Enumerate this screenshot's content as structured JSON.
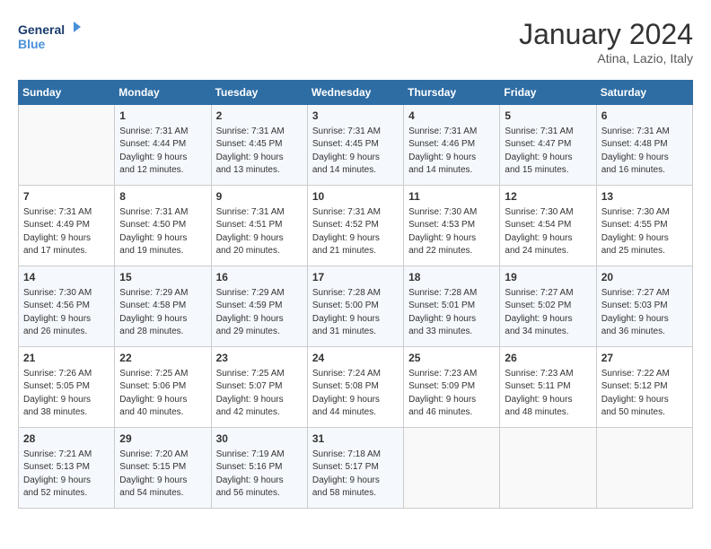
{
  "header": {
    "logo_line1": "General",
    "logo_line2": "Blue",
    "month": "January 2024",
    "location": "Atina, Lazio, Italy"
  },
  "weekdays": [
    "Sunday",
    "Monday",
    "Tuesday",
    "Wednesday",
    "Thursday",
    "Friday",
    "Saturday"
  ],
  "weeks": [
    [
      {
        "day": "",
        "info": ""
      },
      {
        "day": "1",
        "info": "Sunrise: 7:31 AM\nSunset: 4:44 PM\nDaylight: 9 hours\nand 12 minutes."
      },
      {
        "day": "2",
        "info": "Sunrise: 7:31 AM\nSunset: 4:45 PM\nDaylight: 9 hours\nand 13 minutes."
      },
      {
        "day": "3",
        "info": "Sunrise: 7:31 AM\nSunset: 4:45 PM\nDaylight: 9 hours\nand 14 minutes."
      },
      {
        "day": "4",
        "info": "Sunrise: 7:31 AM\nSunset: 4:46 PM\nDaylight: 9 hours\nand 14 minutes."
      },
      {
        "day": "5",
        "info": "Sunrise: 7:31 AM\nSunset: 4:47 PM\nDaylight: 9 hours\nand 15 minutes."
      },
      {
        "day": "6",
        "info": "Sunrise: 7:31 AM\nSunset: 4:48 PM\nDaylight: 9 hours\nand 16 minutes."
      }
    ],
    [
      {
        "day": "7",
        "info": "Sunrise: 7:31 AM\nSunset: 4:49 PM\nDaylight: 9 hours\nand 17 minutes."
      },
      {
        "day": "8",
        "info": "Sunrise: 7:31 AM\nSunset: 4:50 PM\nDaylight: 9 hours\nand 19 minutes."
      },
      {
        "day": "9",
        "info": "Sunrise: 7:31 AM\nSunset: 4:51 PM\nDaylight: 9 hours\nand 20 minutes."
      },
      {
        "day": "10",
        "info": "Sunrise: 7:31 AM\nSunset: 4:52 PM\nDaylight: 9 hours\nand 21 minutes."
      },
      {
        "day": "11",
        "info": "Sunrise: 7:30 AM\nSunset: 4:53 PM\nDaylight: 9 hours\nand 22 minutes."
      },
      {
        "day": "12",
        "info": "Sunrise: 7:30 AM\nSunset: 4:54 PM\nDaylight: 9 hours\nand 24 minutes."
      },
      {
        "day": "13",
        "info": "Sunrise: 7:30 AM\nSunset: 4:55 PM\nDaylight: 9 hours\nand 25 minutes."
      }
    ],
    [
      {
        "day": "14",
        "info": "Sunrise: 7:30 AM\nSunset: 4:56 PM\nDaylight: 9 hours\nand 26 minutes."
      },
      {
        "day": "15",
        "info": "Sunrise: 7:29 AM\nSunset: 4:58 PM\nDaylight: 9 hours\nand 28 minutes."
      },
      {
        "day": "16",
        "info": "Sunrise: 7:29 AM\nSunset: 4:59 PM\nDaylight: 9 hours\nand 29 minutes."
      },
      {
        "day": "17",
        "info": "Sunrise: 7:28 AM\nSunset: 5:00 PM\nDaylight: 9 hours\nand 31 minutes."
      },
      {
        "day": "18",
        "info": "Sunrise: 7:28 AM\nSunset: 5:01 PM\nDaylight: 9 hours\nand 33 minutes."
      },
      {
        "day": "19",
        "info": "Sunrise: 7:27 AM\nSunset: 5:02 PM\nDaylight: 9 hours\nand 34 minutes."
      },
      {
        "day": "20",
        "info": "Sunrise: 7:27 AM\nSunset: 5:03 PM\nDaylight: 9 hours\nand 36 minutes."
      }
    ],
    [
      {
        "day": "21",
        "info": "Sunrise: 7:26 AM\nSunset: 5:05 PM\nDaylight: 9 hours\nand 38 minutes."
      },
      {
        "day": "22",
        "info": "Sunrise: 7:25 AM\nSunset: 5:06 PM\nDaylight: 9 hours\nand 40 minutes."
      },
      {
        "day": "23",
        "info": "Sunrise: 7:25 AM\nSunset: 5:07 PM\nDaylight: 9 hours\nand 42 minutes."
      },
      {
        "day": "24",
        "info": "Sunrise: 7:24 AM\nSunset: 5:08 PM\nDaylight: 9 hours\nand 44 minutes."
      },
      {
        "day": "25",
        "info": "Sunrise: 7:23 AM\nSunset: 5:09 PM\nDaylight: 9 hours\nand 46 minutes."
      },
      {
        "day": "26",
        "info": "Sunrise: 7:23 AM\nSunset: 5:11 PM\nDaylight: 9 hours\nand 48 minutes."
      },
      {
        "day": "27",
        "info": "Sunrise: 7:22 AM\nSunset: 5:12 PM\nDaylight: 9 hours\nand 50 minutes."
      }
    ],
    [
      {
        "day": "28",
        "info": "Sunrise: 7:21 AM\nSunset: 5:13 PM\nDaylight: 9 hours\nand 52 minutes."
      },
      {
        "day": "29",
        "info": "Sunrise: 7:20 AM\nSunset: 5:15 PM\nDaylight: 9 hours\nand 54 minutes."
      },
      {
        "day": "30",
        "info": "Sunrise: 7:19 AM\nSunset: 5:16 PM\nDaylight: 9 hours\nand 56 minutes."
      },
      {
        "day": "31",
        "info": "Sunrise: 7:18 AM\nSunset: 5:17 PM\nDaylight: 9 hours\nand 58 minutes."
      },
      {
        "day": "",
        "info": ""
      },
      {
        "day": "",
        "info": ""
      },
      {
        "day": "",
        "info": ""
      }
    ]
  ]
}
